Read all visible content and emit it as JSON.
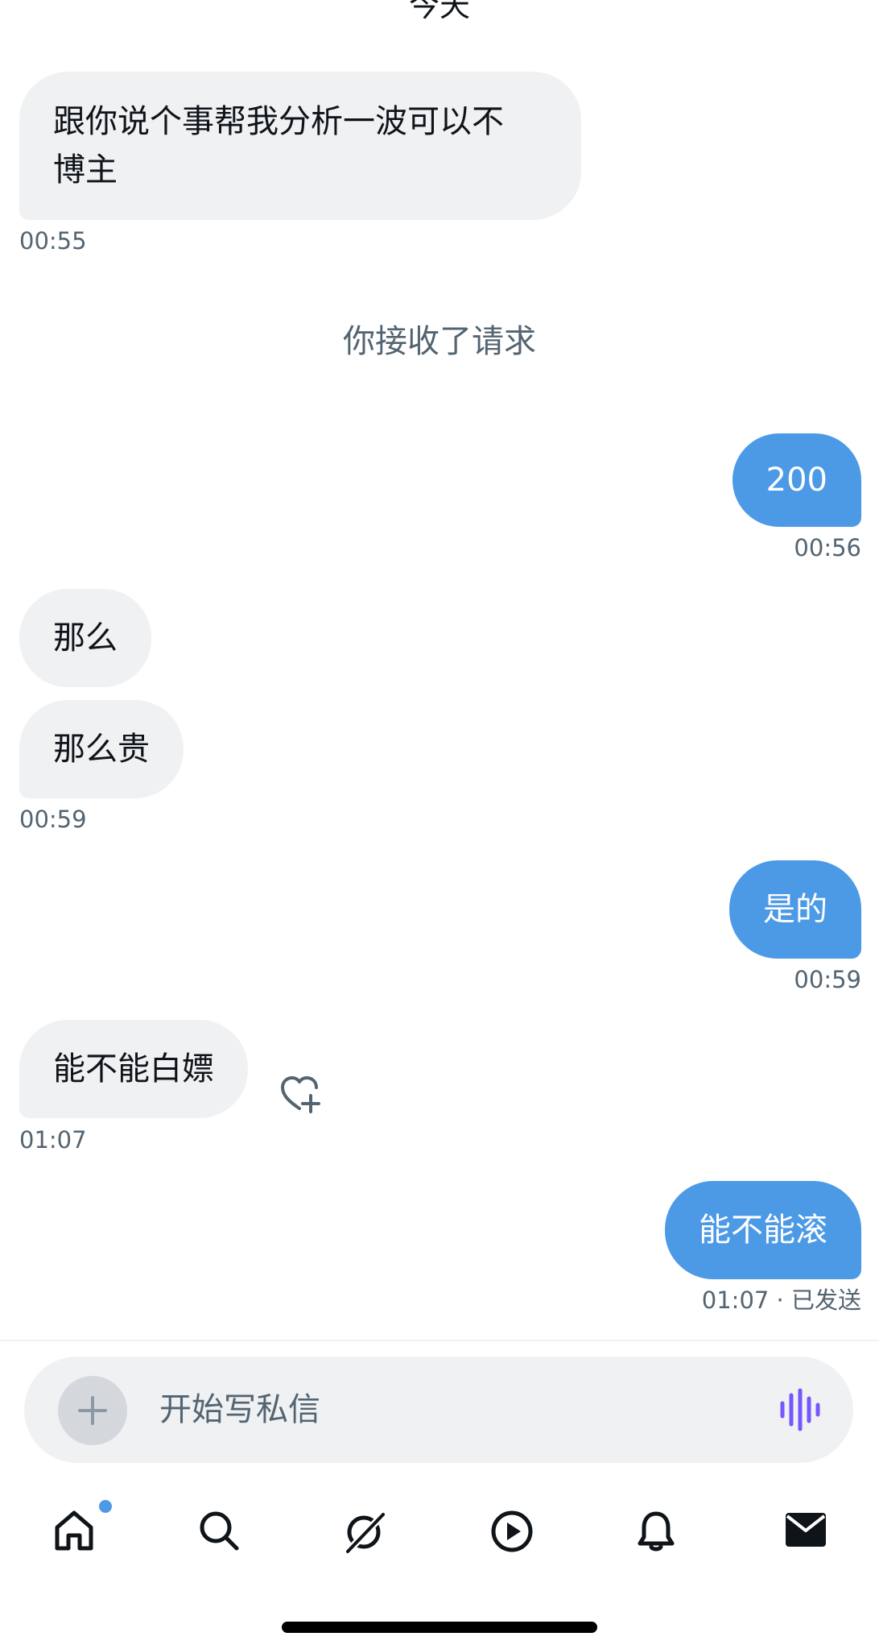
{
  "date_header": "今天",
  "messages": [
    {
      "direction": "in",
      "text_lines": [
        "跟你说个事帮我分析一波可以不",
        "博主"
      ],
      "time": "00:55"
    },
    {
      "system": "你接收了请求"
    },
    {
      "direction": "out",
      "text": "200",
      "time": "00:56"
    },
    {
      "direction": "in",
      "text": "那么"
    },
    {
      "direction": "in",
      "text": "那么贵",
      "time": "00:59"
    },
    {
      "direction": "out",
      "text": "是的",
      "time": "00:59"
    },
    {
      "direction": "in",
      "text": "能不能白嫖",
      "time": "01:07",
      "reaction_icon": "heart-plus-icon"
    },
    {
      "direction": "out",
      "text": "能不能滚",
      "time": "01:07 · 已发送"
    }
  ],
  "composer": {
    "placeholder": "开始写私信",
    "add_icon": "plus-icon",
    "voice_icon": "voice-wave-icon"
  },
  "tabbar": {
    "items": [
      {
        "icon": "home-icon",
        "active": true,
        "badge_dot": true
      },
      {
        "icon": "search-icon"
      },
      {
        "icon": "grok-icon"
      },
      {
        "icon": "play-icon"
      },
      {
        "icon": "bell-icon"
      },
      {
        "icon": "mail-icon",
        "active": true
      }
    ]
  },
  "colors": {
    "outgoing_bubble": "#4c9ae6",
    "incoming_bubble": "#eff1f3",
    "secondary_text": "#536471",
    "voice_icon": "#7856ff"
  }
}
